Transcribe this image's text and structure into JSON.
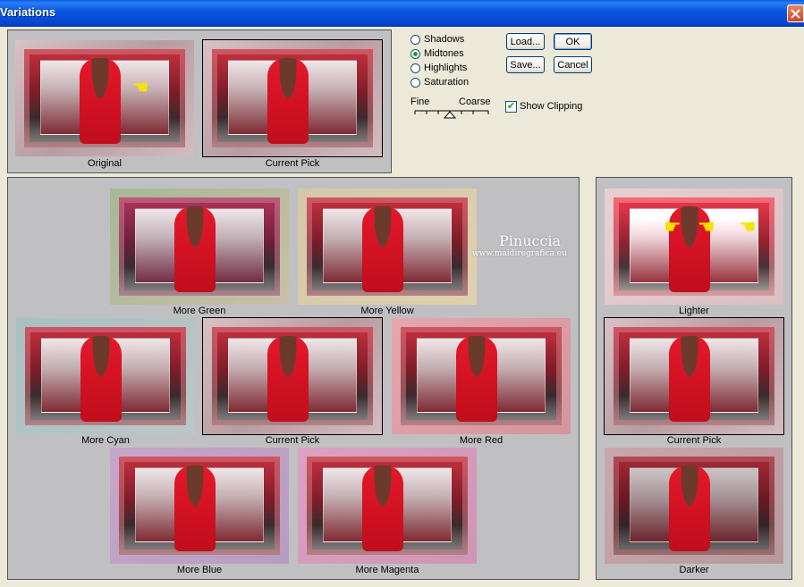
{
  "window": {
    "title": "Variations",
    "close_icon": "close-icon"
  },
  "preview": {
    "original_label": "Original",
    "current_pick_label": "Current Pick"
  },
  "tones": {
    "options": [
      "Shadows",
      "Midtones",
      "Highlights",
      "Saturation"
    ],
    "selected": "Midtones"
  },
  "slider": {
    "fine_label": "Fine",
    "coarse_label": "Coarse",
    "level": 0.5
  },
  "buttons": {
    "load": "Load...",
    "ok": "OK",
    "save": "Save...",
    "cancel": "Cancel"
  },
  "show_clipping": {
    "label": "Show Clipping",
    "checked": true
  },
  "color_variations": [
    {
      "label": "More Green",
      "tint": "#6aa35a"
    },
    {
      "label": "More Yellow",
      "tint": "#d8c25a"
    },
    {
      "label": "More Cyan",
      "tint": "#6aaab0"
    },
    {
      "label": "Current Pick",
      "tint": "#c0a0a5"
    },
    {
      "label": "More Red",
      "tint": "#e05060"
    },
    {
      "label": "More Blue",
      "tint": "#8c78c0"
    },
    {
      "label": "More Magenta",
      "tint": "#d060a0"
    }
  ],
  "brightness_variations": [
    {
      "label": "Lighter"
    },
    {
      "label": "Current Pick"
    },
    {
      "label": "Darker"
    }
  ],
  "watermark": {
    "name": "Pinuccia",
    "url": "www.maidiregrafica.eu"
  }
}
